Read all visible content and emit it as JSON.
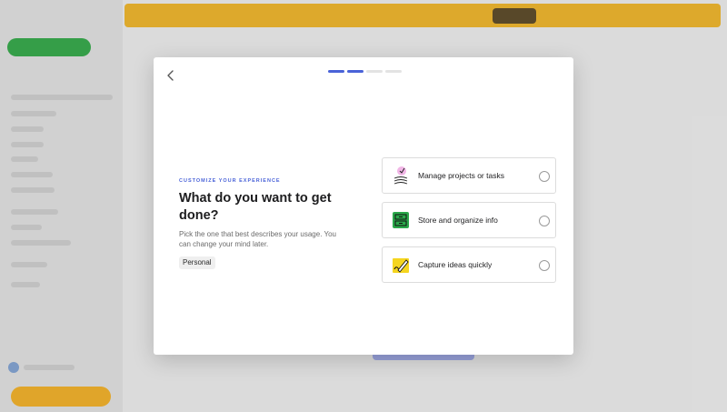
{
  "onboarding": {
    "eyebrow": "CUSTOMIZE YOUR EXPERIENCE",
    "title": "What do you want to get done?",
    "description": "Pick the one that best describes your usage. You can change your mind later.",
    "selected_usage": "Personal",
    "steps": {
      "total": 4,
      "current": 2
    },
    "options": [
      {
        "label": "Manage projects or tasks",
        "icon": "projects-icon",
        "selected": false
      },
      {
        "label": "Store and organize info",
        "icon": "cabinet-icon",
        "selected": false
      },
      {
        "label": "Capture ideas quickly",
        "icon": "pen-note-icon",
        "selected": false
      }
    ]
  },
  "colors": {
    "accent": "#4a63d8",
    "banner": "#e2ad2d",
    "green": "#37a24a",
    "yellow_icon": "#f5d51f",
    "green_icon": "#2aa84a"
  }
}
